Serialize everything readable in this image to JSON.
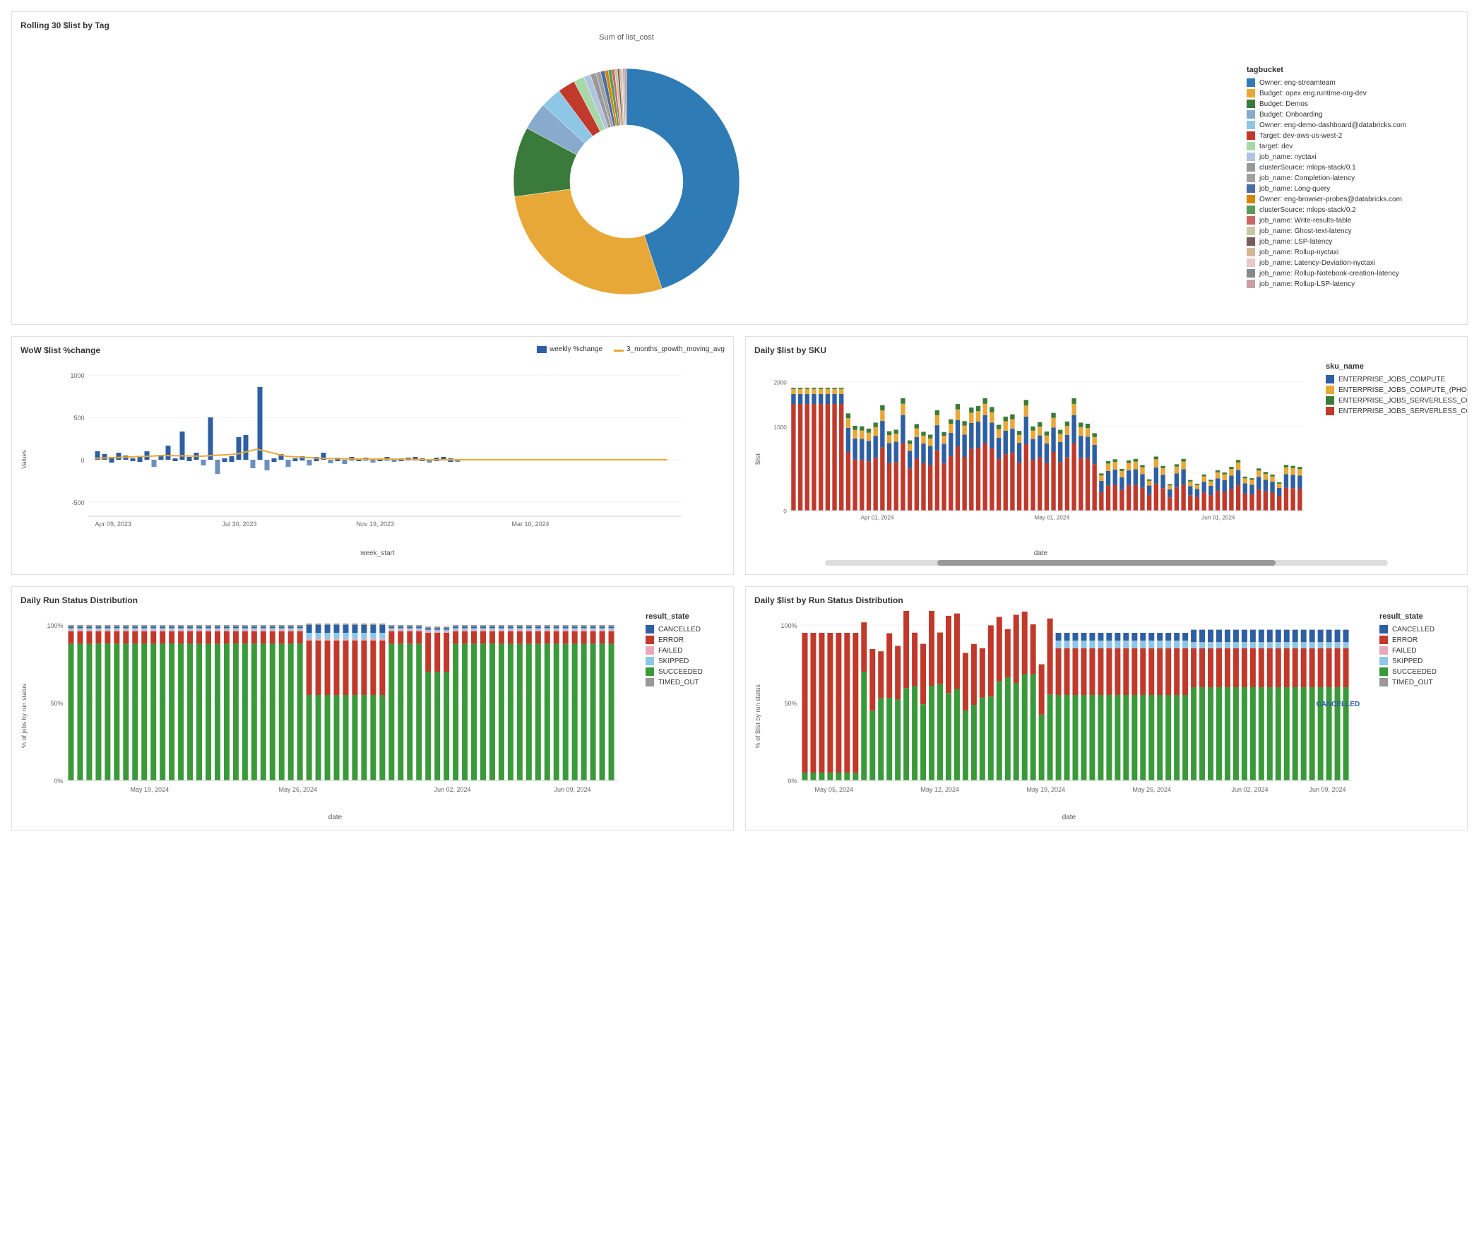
{
  "top_chart": {
    "title": "Rolling 30 $list by Tag",
    "subtitle": "Sum of list_cost",
    "legend_title": "tagbucket",
    "legend_items": [
      {
        "label": "Owner: eng-streamteam",
        "color": "#2e7bb5"
      },
      {
        "label": "Budget: opex.eng.runtime-org-dev",
        "color": "#e8a838"
      },
      {
        "label": "Budget: Demos",
        "color": "#3a7a3a"
      },
      {
        "label": "Budget: Onboarding",
        "color": "#88aacc"
      },
      {
        "label": "Owner: eng-demo-dashboard@databricks.com",
        "color": "#8ec6e6"
      },
      {
        "label": "Target: dev-aws-us-west-2",
        "color": "#c0392b"
      },
      {
        "label": "target: dev",
        "color": "#a8d8a8"
      },
      {
        "label": "job_name: nyctaxi",
        "color": "#b0c4de"
      },
      {
        "label": "clusterSource: mlops-stack/0.1",
        "color": "#999999"
      },
      {
        "label": "job_name: Completion-latency",
        "color": "#a0a0a0"
      },
      {
        "label": "job_name: Long-query",
        "color": "#4a6fa5"
      },
      {
        "label": "Owner: eng-browser-probes@databricks.com",
        "color": "#d4860a"
      },
      {
        "label": "clusterSource: mlops-stack/0.2",
        "color": "#5a9a5a"
      },
      {
        "label": "job_name: Write-results-table",
        "color": "#cc6666"
      },
      {
        "label": "job_name: Ghost-text-latency",
        "color": "#c8c8a0"
      },
      {
        "label": "job_name: LSP-latency",
        "color": "#7a5a5a"
      },
      {
        "label": "job_name: Rollup-nyctaxi",
        "color": "#d4b896"
      },
      {
        "label": "job_name: Latency-Deviation-nyctaxi",
        "color": "#e8c8c8"
      },
      {
        "label": "job_name: Rollup-Notebook-creation-latency",
        "color": "#888888"
      },
      {
        "label": "job_name: Rollup-LSP-latency",
        "color": "#c8a0a0"
      }
    ],
    "donut_segments": [
      {
        "color": "#2e7bb5",
        "percent": 45
      },
      {
        "color": "#e8a838",
        "percent": 28
      },
      {
        "color": "#3a7a3a",
        "percent": 10
      },
      {
        "color": "#88aacc",
        "percent": 4
      },
      {
        "color": "#8ec6e6",
        "percent": 3
      },
      {
        "color": "#c0392b",
        "percent": 2.5
      },
      {
        "color": "#a8d8a8",
        "percent": 1.5
      },
      {
        "color": "#b0c4de",
        "percent": 1
      },
      {
        "color": "#999999",
        "percent": 0.8
      },
      {
        "color": "#a0a0a0",
        "percent": 0.7
      },
      {
        "color": "#4a6fa5",
        "percent": 0.6
      },
      {
        "color": "#d4860a",
        "percent": 0.5
      },
      {
        "color": "#5a9a5a",
        "percent": 0.5
      },
      {
        "color": "#cc6666",
        "percent": 0.4
      },
      {
        "color": "#c8c8a0",
        "percent": 0.4
      },
      {
        "color": "#7a5a5a",
        "percent": 0.3
      },
      {
        "color": "#d4b896",
        "percent": 0.3
      },
      {
        "color": "#e8c8c8",
        "percent": 0.2
      },
      {
        "color": "#888888",
        "percent": 0.2
      },
      {
        "color": "#c8a0a0",
        "percent": 0.3
      }
    ]
  },
  "wow_chart": {
    "title": "WoW $list %change",
    "x_label": "week_start",
    "y_label": "Values",
    "x_ticks": [
      "Apr 09, 2023",
      "Jul 30, 2023",
      "Nov 19, 2023",
      "Mar 10, 2024"
    ],
    "y_ticks": [
      "-500",
      "0",
      "500",
      "1000"
    ],
    "legend": [
      {
        "label": "weekly %change",
        "color": "#2e5fa3"
      },
      {
        "label": "3_months_growth_moving_avg",
        "color": "#e8a838"
      }
    ]
  },
  "daily_sku_chart": {
    "title": "Daily $list by SKU",
    "x_label": "date",
    "y_label": "$list",
    "x_ticks": [
      "Apr 01, 2024",
      "May 01, 2024",
      "Jun 01, 2024"
    ],
    "y_ticks": [
      "0",
      "1000",
      "2000"
    ],
    "legend_title": "sku_name",
    "legend_items": [
      {
        "label": "ENTERPRISE_JOBS_COMPUTE",
        "color": "#2e5fa3"
      },
      {
        "label": "ENTERPRISE_JOBS_COMPUTE_(PHOTON)",
        "color": "#e8a838"
      },
      {
        "label": "ENTERPRISE_JOBS_SERVERLESS_COMPUTE_U",
        "color": "#3a7a3a"
      },
      {
        "label": "ENTERPRISE_JOBS_SERVERLESS_COMPUTE_U",
        "color": "#c0392b"
      }
    ]
  },
  "daily_run_status_chart": {
    "title": "Daily Run Status Distribution",
    "x_label": "date",
    "y_label": "% of jobs by run status",
    "x_ticks": [
      "May 19, 2024",
      "May 26, 2024",
      "Jun 02, 2024",
      "Jun 09, 2024"
    ],
    "y_ticks": [
      "0%",
      "50%",
      "100%"
    ],
    "legend_title": "result_state",
    "legend_items": [
      {
        "label": "CANCELLED",
        "color": "#2e5fa3"
      },
      {
        "label": "ERROR",
        "color": "#c0392b"
      },
      {
        "label": "FAILED",
        "color": "#e8aabb"
      },
      {
        "label": "SKIPPED",
        "color": "#8ec6e6"
      },
      {
        "label": "SUCCEEDED",
        "color": "#3a9a3a"
      },
      {
        "label": "TIMED_OUT",
        "color": "#999999"
      }
    ]
  },
  "daily_list_run_chart": {
    "title": "Daily $list by Run Status Distribution",
    "x_label": "date",
    "y_label": "% of $list by run status",
    "x_ticks": [
      "May 05, 2024",
      "May 12, 2024",
      "May 19, 2024",
      "May 26, 2024",
      "Jun 02, 2024",
      "Jun 09, 2024"
    ],
    "y_ticks": [
      "0%",
      "50%",
      "100%"
    ],
    "legend_title": "result_state",
    "legend_items": [
      {
        "label": "CANCELLED",
        "color": "#2e5fa3"
      },
      {
        "label": "ERROR",
        "color": "#c0392b"
      },
      {
        "label": "FAILED",
        "color": "#e8aabb"
      },
      {
        "label": "SKIPPED",
        "color": "#8ec6e6"
      },
      {
        "label": "SUCCEEDED",
        "color": "#3a9a3a"
      },
      {
        "label": "TIMED_OUT",
        "color": "#999999"
      }
    ],
    "cancelled_badge": "CANCELLED"
  }
}
